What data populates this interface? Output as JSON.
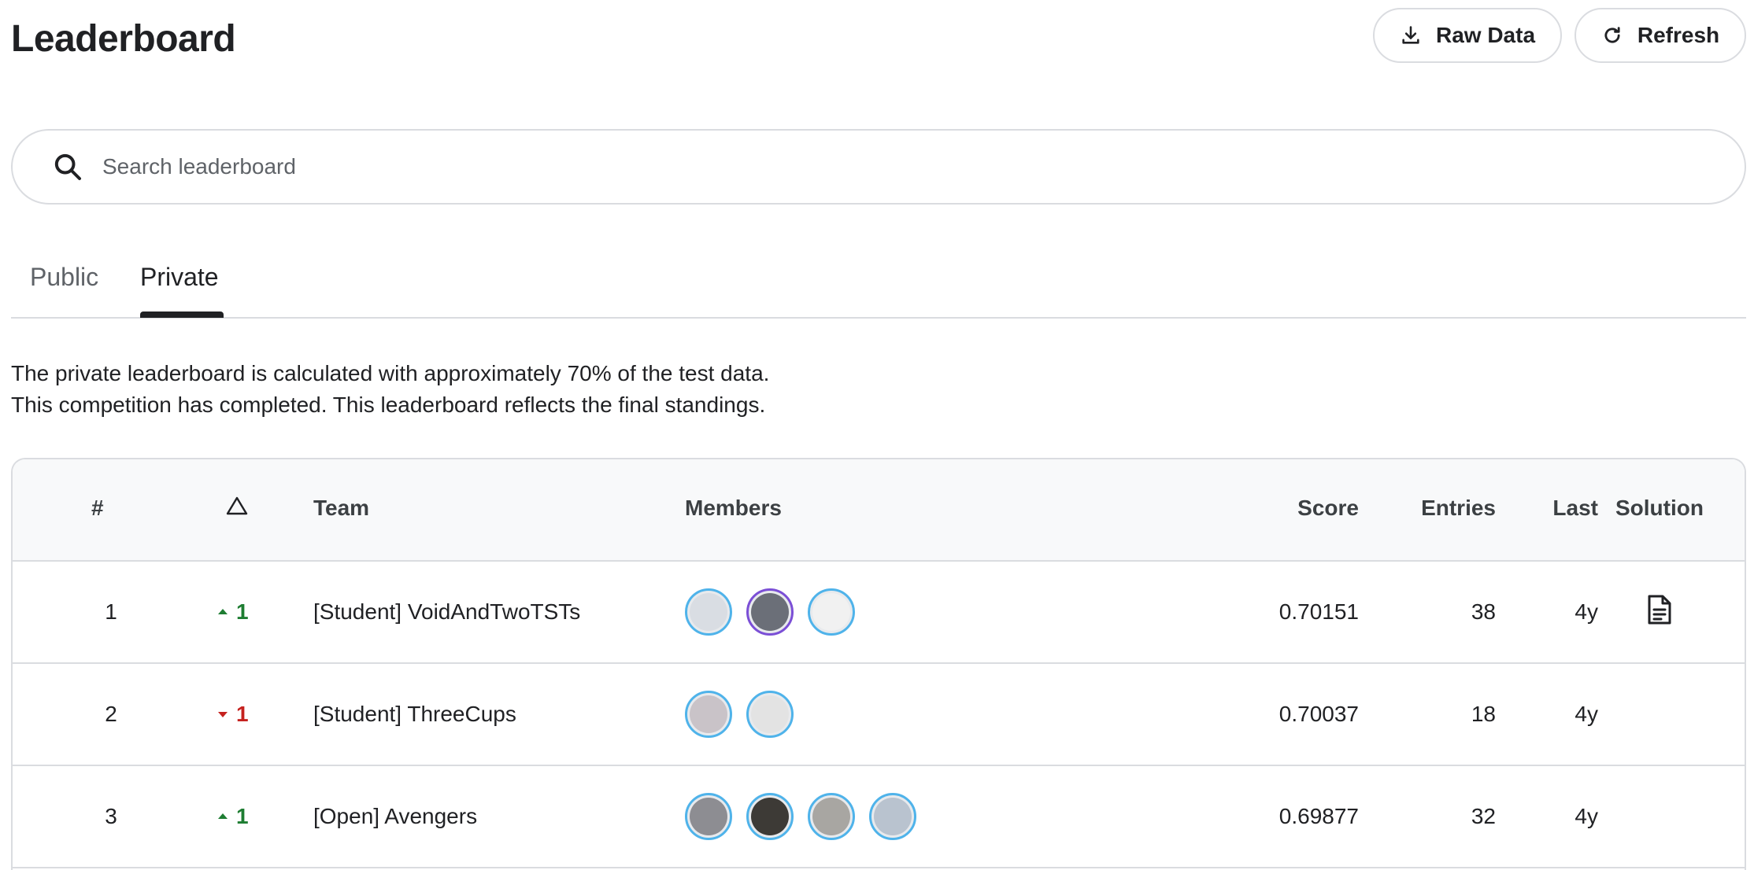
{
  "header": {
    "title": "Leaderboard",
    "raw_data_label": "Raw Data",
    "refresh_label": "Refresh"
  },
  "search": {
    "placeholder": "Search leaderboard",
    "value": ""
  },
  "tabs": [
    {
      "label": "Public",
      "active": false
    },
    {
      "label": "Private",
      "active": true
    }
  ],
  "info": {
    "line1": "The private leaderboard is calculated with approximately 70% of the test data.",
    "line2": "This competition has completed. This leaderboard reflects the final standings."
  },
  "table": {
    "columns": {
      "rank": "#",
      "team": "Team",
      "members": "Members",
      "score": "Score",
      "entries": "Entries",
      "last": "Last",
      "solution": "Solution"
    },
    "rows": [
      {
        "rank": "1",
        "delta_direction": "up",
        "delta": "1",
        "team": "[Student] VoidAndTwoTSTs",
        "members": [
          {
            "border": "#4fb3ea",
            "fill": "#d9dde3"
          },
          {
            "border": "#7b4fd6",
            "fill": "#6b6f78"
          },
          {
            "border": "#4fb3ea",
            "fill": "#f1f1f1"
          }
        ],
        "score": "0.70151",
        "entries": "38",
        "last": "4y",
        "solution_icon": "document-icon"
      },
      {
        "rank": "2",
        "delta_direction": "down",
        "delta": "1",
        "team": "[Student] ThreeCups",
        "members": [
          {
            "border": "#4fb3ea",
            "fill": "#c9c3c8"
          },
          {
            "border": "#4fb3ea",
            "fill": "#e3e3e3"
          }
        ],
        "score": "0.70037",
        "entries": "18",
        "last": "4y",
        "solution_icon": ""
      },
      {
        "rank": "3",
        "delta_direction": "up",
        "delta": "1",
        "team": "[Open] Avengers",
        "members": [
          {
            "border": "#4fb3ea",
            "fill": "#8d8d92"
          },
          {
            "border": "#4fb3ea",
            "fill": "#3d3a36"
          },
          {
            "border": "#4fb3ea",
            "fill": "#a8a6a2"
          },
          {
            "border": "#4fb3ea",
            "fill": "#b9c3cf"
          }
        ],
        "score": "0.69877",
        "entries": "32",
        "last": "4y",
        "solution_icon": ""
      }
    ]
  },
  "colors": {
    "delta_up": "#1e7d32",
    "delta_down": "#c5221f",
    "border": "#dadce0",
    "header_bg": "#f8f9fa"
  }
}
